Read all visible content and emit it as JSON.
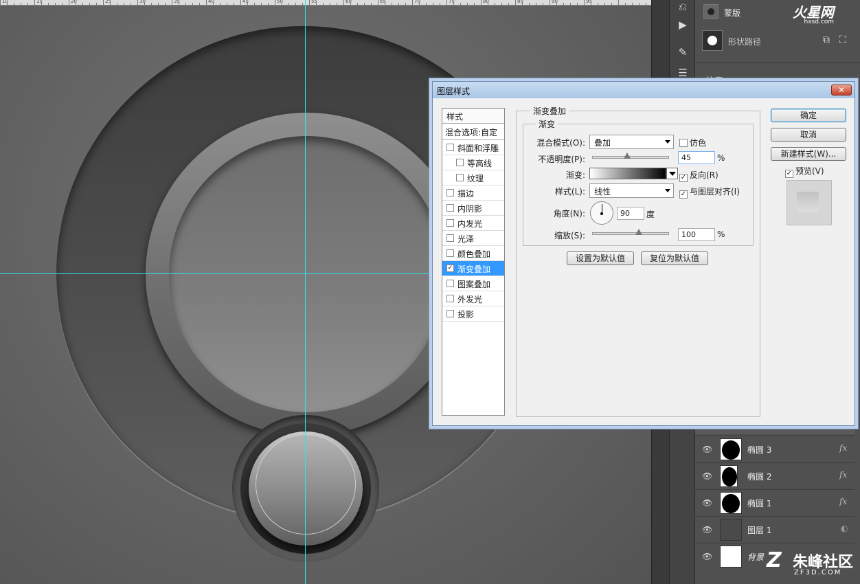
{
  "ruler": {
    "labels": [
      "10",
      "15",
      "20",
      "25",
      "30",
      "35",
      "40",
      "45",
      "50",
      "55",
      "60",
      "65",
      "70",
      "75",
      "80",
      "85",
      "90",
      "95"
    ]
  },
  "right_panel": {
    "mask_label": "蒙版",
    "shape_path_label": "形状路径",
    "density_label": "浓度:",
    "watermark_top": "火星网",
    "watermark_top_url": "hxsd.com"
  },
  "layers": [
    {
      "name": "椭圆 3",
      "fx": "fx"
    },
    {
      "name": "椭圆 2",
      "fx": "fx"
    },
    {
      "name": "椭圆 1",
      "fx": "fx"
    },
    {
      "name": "图层 1",
      "fx": ""
    },
    {
      "name": "背景",
      "fx": ""
    }
  ],
  "watermark_bottom": {
    "text": "朱峰社区",
    "url": "ZF3D.COM"
  },
  "dialog": {
    "title": "图层样式",
    "close": "✕",
    "style_header": "样式",
    "blend_options": "混合选项:自定",
    "styles": [
      {
        "label": "斜面和浮雕",
        "checked": "",
        "sub": false,
        "active": false
      },
      {
        "label": "等高线",
        "checked": "",
        "sub": true,
        "active": false
      },
      {
        "label": "纹理",
        "checked": "",
        "sub": true,
        "active": false
      },
      {
        "label": "描边",
        "checked": "",
        "sub": false,
        "active": false
      },
      {
        "label": "内阴影",
        "checked": "",
        "sub": false,
        "active": false
      },
      {
        "label": "内发光",
        "checked": "",
        "sub": false,
        "active": false
      },
      {
        "label": "光泽",
        "checked": "",
        "sub": false,
        "active": false
      },
      {
        "label": "颜色叠加",
        "checked": "",
        "sub": false,
        "active": false
      },
      {
        "label": "渐变叠加",
        "checked": "✓",
        "sub": false,
        "active": true
      },
      {
        "label": "图案叠加",
        "checked": "",
        "sub": false,
        "active": false
      },
      {
        "label": "外发光",
        "checked": "",
        "sub": false,
        "active": false
      },
      {
        "label": "投影",
        "checked": "",
        "sub": false,
        "active": false
      }
    ],
    "section_title": "渐变叠加",
    "group_title": "渐变",
    "blend_mode_label": "混合模式(O):",
    "blend_mode_value": "叠加",
    "dither_label": "仿色",
    "opacity_label": "不透明度(P):",
    "opacity_value": "45",
    "opacity_level": 0.45,
    "percent": "%",
    "gradient_label": "渐变:",
    "reverse_label": "反向(R)",
    "style_label": "样式(L):",
    "style_value": "线性",
    "align_label": "与图层对齐(I)",
    "angle_label": "角度(N):",
    "angle_value": "90",
    "degree": "度",
    "scale_label": "缩放(S):",
    "scale_value": "100",
    "set_default": "设置为默认值",
    "reset_default": "复位为默认值",
    "ok": "确定",
    "cancel": "取消",
    "new_style": "新建样式(W)...",
    "preview_label": "预览(V)"
  }
}
